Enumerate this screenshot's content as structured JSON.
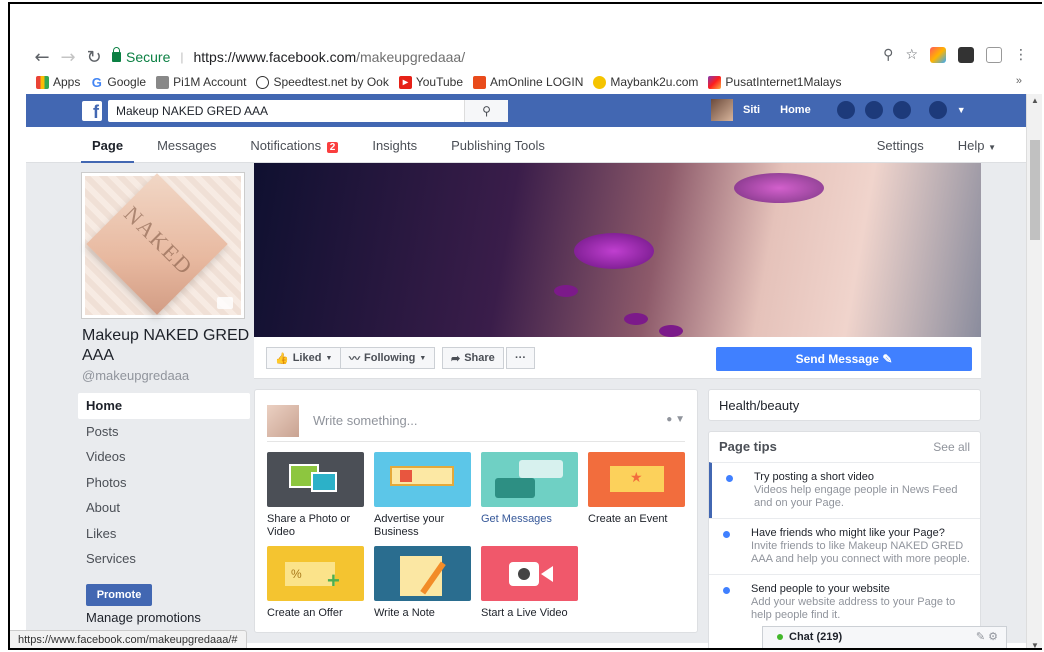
{
  "browser": {
    "secure_label": "Secure",
    "url_host": "https://www.facebook.com",
    "url_path": "/makeupgredaaa/",
    "bookmarks": [
      "Apps",
      "Google",
      "Pi1M Account",
      "Speedtest.net by Ook",
      "YouTube",
      "AmOnline LOGIN",
      "Maybank2u.com",
      "PusatInternet1Malays"
    ],
    "bookmarks_more": "»"
  },
  "fbbar": {
    "search_value": "Makeup NAKED GRED AAA",
    "user_name": "Siti",
    "home_label": "Home"
  },
  "tabs": {
    "page": "Page",
    "messages": "Messages",
    "notifications": "Notifications",
    "notifications_count": "2",
    "insights": "Insights",
    "publishing_tools": "Publishing Tools",
    "settings": "Settings",
    "help": "Help"
  },
  "profile": {
    "name": "Makeup NAKED GRED AAA",
    "handle": "@makeupgredaaa",
    "pic_text": "NAKED"
  },
  "leftnav": [
    "Home",
    "Posts",
    "Videos",
    "Photos",
    "About",
    "Likes",
    "Services"
  ],
  "promote_label": "Promote",
  "manage_promotions": "Manage promotions",
  "actions": {
    "liked": "Liked",
    "following": "Following",
    "share": "Share",
    "more": "···",
    "send_message": "Send Message"
  },
  "composer": {
    "placeholder": "Write something...",
    "tiles": [
      "Share a Photo or Video",
      "Advertise your Business",
      "Get Messages",
      "Create an Event",
      "Create an Offer",
      "Write a Note",
      "Start a Live Video"
    ]
  },
  "sidebar": {
    "category": "Health/beauty",
    "tips_title": "Page tips",
    "see_all": "See all",
    "tips": [
      {
        "title": "Try posting a short video",
        "desc": "Videos help engage people in News Feed and on your Page."
      },
      {
        "title": "Have friends who might like your Page?",
        "desc": "Invite friends to like Makeup NAKED GRED AAA and help you connect with more people."
      },
      {
        "title": "Send people to your website",
        "desc": "Add your website address to your Page to help people find it."
      }
    ]
  },
  "status_url": "https://www.facebook.com/makeupgredaaa/#",
  "chat_label": "Chat (219)"
}
